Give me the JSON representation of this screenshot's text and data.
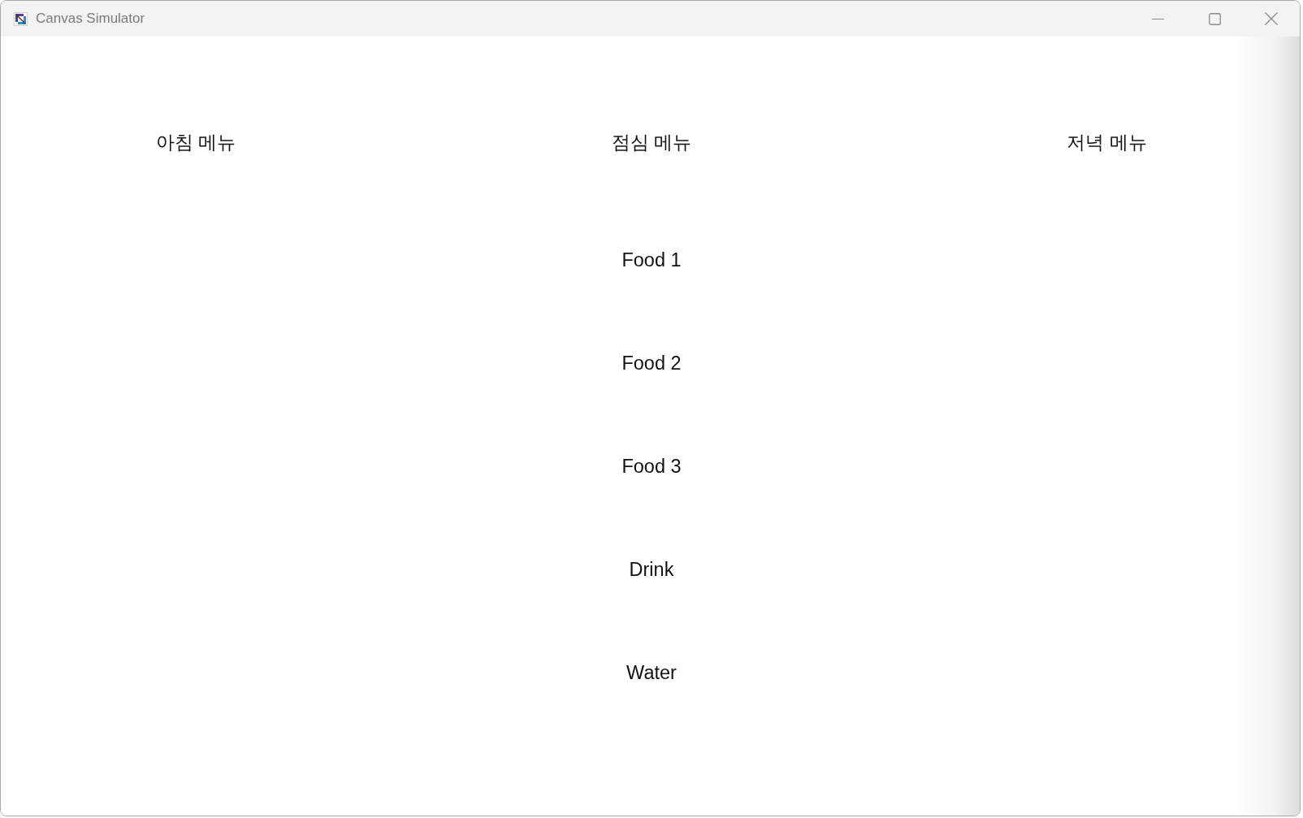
{
  "window": {
    "title": "Canvas Simulator"
  },
  "columns": [
    {
      "heading": "아침 메뉴"
    },
    {
      "heading": "점심 메뉴",
      "items": [
        "Food 1",
        "Food 2",
        "Food 3",
        "Drink",
        "Water"
      ]
    },
    {
      "heading": "저녁 메뉴"
    }
  ]
}
